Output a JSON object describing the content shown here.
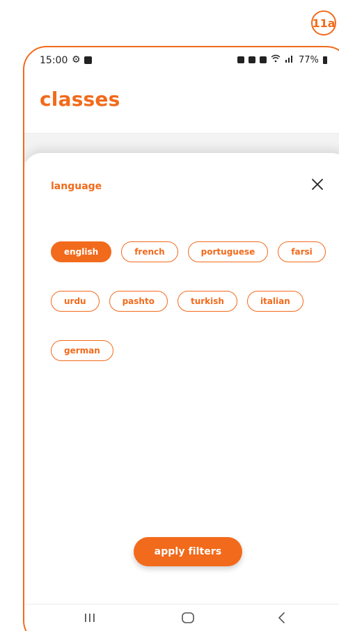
{
  "badge": {
    "label": "11a"
  },
  "status_bar": {
    "time": "15:00",
    "battery": "77%"
  },
  "page": {
    "title": "classes"
  },
  "sheet": {
    "title": "language",
    "chips": [
      {
        "label": "english",
        "selected": true
      },
      {
        "label": "french",
        "selected": false
      },
      {
        "label": "portuguese",
        "selected": false
      },
      {
        "label": "farsi",
        "selected": false
      },
      {
        "label": "urdu",
        "selected": false
      },
      {
        "label": "pashto",
        "selected": false
      },
      {
        "label": "turkish",
        "selected": false
      },
      {
        "label": "italian",
        "selected": false
      },
      {
        "label": "german",
        "selected": false
      }
    ],
    "apply_label": "apply filters"
  },
  "icons": {
    "close": "close-icon",
    "settings": "gear-icon",
    "recent_apps": "recent-apps-icon",
    "home": "home-icon",
    "back": "back-icon"
  },
  "colors": {
    "accent": "#f26a1b",
    "text": "#222222",
    "divider": "#ececec"
  }
}
